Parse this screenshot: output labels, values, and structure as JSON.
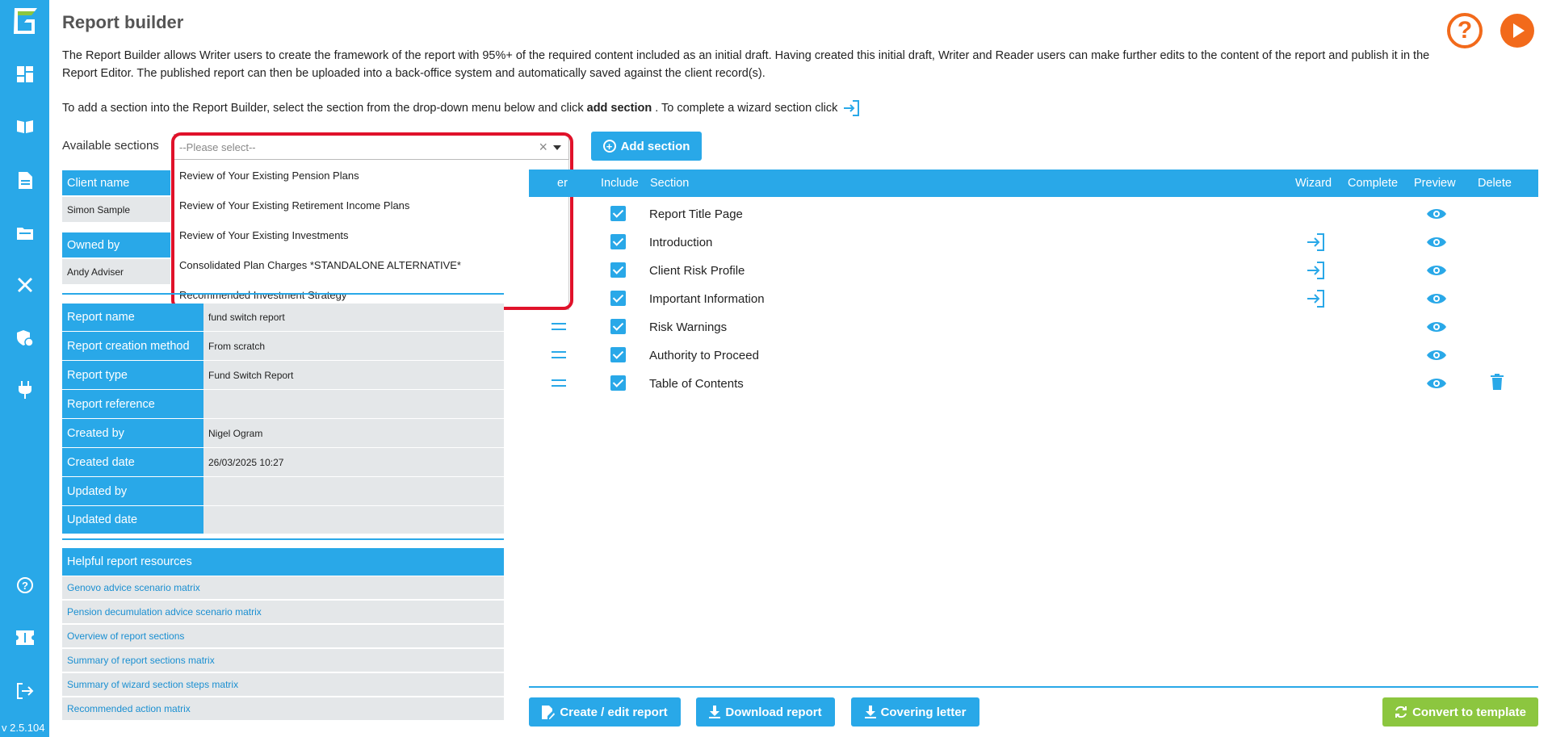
{
  "app": {
    "version": "v 2.5.104",
    "page_title": "Report builder",
    "intro_text": "The Report Builder allows Writer users to create the framework of the report with 95%+ of the required content included as an initial draft. Having created this initial draft, Writer and Reader users can make further edits to the content of the report and publish it in the Report Editor. The published report can then be uploaded into a back-office system and automatically saved against the client record(s).",
    "intro2_prefix": "To add a section into the Report Builder, select the section from the drop-down menu below and click",
    "intro2_bold": "add section",
    "intro2_suffix": ". To complete a wizard section click"
  },
  "sections_picker": {
    "label": "Available sections",
    "placeholder": "--Please select--",
    "options": [
      "Review of Your Existing Pension Plans",
      "Review of Your Existing Retirement Income Plans",
      "Review of Your Existing Investments",
      "Consolidated Plan Charges *STANDALONE ALTERNATIVE*",
      "Recommended Investment Strategy"
    ],
    "add_button": "Add section"
  },
  "client": {
    "client_name_label": "Client name",
    "client_name": "Simon Sample",
    "owned_by_label": "Owned by",
    "owned_by": "Andy Adviser"
  },
  "report_info": [
    {
      "label": "Report name",
      "value": "fund switch report"
    },
    {
      "label": "Report creation method",
      "value": "From scratch"
    },
    {
      "label": "Report type",
      "value": "Fund Switch Report"
    },
    {
      "label": "Report reference",
      "value": ""
    },
    {
      "label": "Created by",
      "value": "Nigel Ogram"
    },
    {
      "label": "Created date",
      "value": "26/03/2025 10:27"
    },
    {
      "label": "Updated by",
      "value": ""
    },
    {
      "label": "Updated date",
      "value": ""
    }
  ],
  "resources": {
    "header": "Helpful report resources",
    "items": [
      "Genovo advice scenario matrix",
      "Pension decumulation advice scenario matrix",
      "Overview of report sections",
      "Summary of report sections matrix",
      "Summary of wizard section steps matrix",
      "Recommended action matrix"
    ]
  },
  "table": {
    "headers": {
      "order": "er",
      "include": "Include",
      "section": "Section",
      "wizard": "Wizard",
      "complete": "Complete",
      "preview": "Preview",
      "delete": "Delete"
    },
    "rows": [
      {
        "name": "Report Title Page",
        "wizard": false,
        "delete": false,
        "drag": false
      },
      {
        "name": "Introduction",
        "wizard": true,
        "delete": false,
        "drag": false
      },
      {
        "name": "Client Risk Profile",
        "wizard": true,
        "delete": false,
        "drag": false
      },
      {
        "name": "Important Information",
        "wizard": true,
        "delete": false,
        "drag": false
      },
      {
        "name": "Risk Warnings",
        "wizard": false,
        "delete": false,
        "drag": true
      },
      {
        "name": "Authority to Proceed",
        "wizard": false,
        "delete": false,
        "drag": true
      },
      {
        "name": "Table of Contents",
        "wizard": false,
        "delete": true,
        "drag": true
      }
    ]
  },
  "actions": {
    "create_edit": "Create / edit report",
    "download": "Download report",
    "covering": "Covering letter",
    "convert": "Convert to template"
  },
  "colors": {
    "brand_blue": "#29a8e8",
    "accent_orange": "#f26a1b",
    "green": "#8cc63f",
    "highlight_red": "#e0122a"
  }
}
